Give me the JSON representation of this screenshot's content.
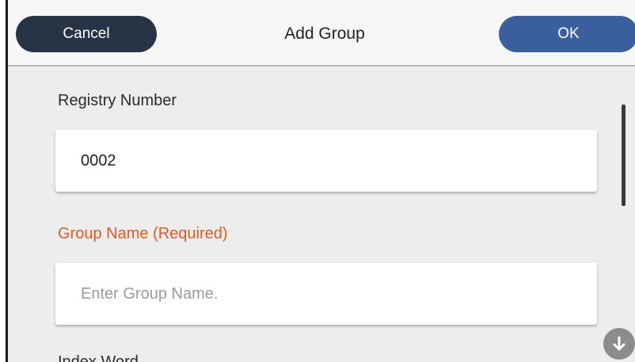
{
  "header": {
    "cancel_label": "Cancel",
    "title": "Add Group",
    "ok_label": "OK"
  },
  "form": {
    "registry_number": {
      "label": "Registry Number",
      "value": "0002"
    },
    "group_name": {
      "label": "Group Name (Required)",
      "placeholder": "Enter Group Name."
    },
    "index_word": {
      "label": "Index Word"
    }
  },
  "icons": {
    "scroll_down": "arrow-down-icon"
  },
  "colors": {
    "cancel_button": "#263445",
    "ok_button": "#3b5f9c",
    "required_label": "#e05a1e",
    "background": "#ededed"
  }
}
